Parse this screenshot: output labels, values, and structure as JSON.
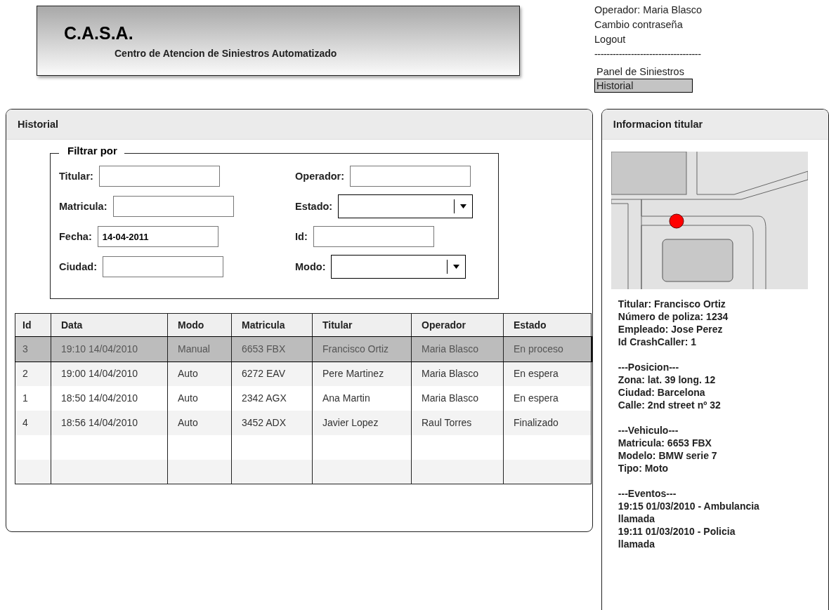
{
  "header": {
    "logo": "C.A.S.A.",
    "subtitle": "Centro de Atencion  de Siniestros Automatizado"
  },
  "user_menu": {
    "operator": "Operador: Maria Blasco",
    "change_password": "Cambio contraseña",
    "logout": "Logout",
    "separator": "-----------------------------------",
    "items": [
      {
        "label": "Panel de Siniestros",
        "selected": false
      },
      {
        "label": "Historial",
        "selected": true
      }
    ]
  },
  "history_panel": {
    "title": "Historial",
    "filter": {
      "legend": "Filtrar por",
      "fields": [
        {
          "label": "Titular:",
          "kind": "text"
        },
        {
          "label": "Operador:",
          "kind": "text"
        },
        {
          "label": "Matricula:",
          "kind": "text"
        },
        {
          "label": "Estado:",
          "kind": "select"
        },
        {
          "label": "Fecha:",
          "kind": "text",
          "value": "14-04-2011"
        },
        {
          "label": "Id:",
          "kind": "text"
        },
        {
          "label": "Ciudad:",
          "kind": "text"
        },
        {
          "label": "Modo:",
          "kind": "select"
        }
      ]
    },
    "table": {
      "columns": [
        "Id",
        "Data",
        "Modo",
        "Matricula",
        "Titular",
        "Operador",
        "Estado"
      ],
      "rows": [
        {
          "cells": [
            "3",
            "19:10 14/04/2010",
            "Manual",
            "6653 FBX",
            "Francisco Ortiz",
            "Maria Blasco",
            "En proceso"
          ],
          "selected": true
        },
        {
          "cells": [
            "2",
            "19:00 14/04/2010",
            "Auto",
            "6272 EAV",
            "Pere Martinez",
            "Maria Blasco",
            "En espera"
          ],
          "selected": false
        },
        {
          "cells": [
            "1",
            "18:50 14/04/2010",
            "Auto",
            "2342 AGX",
            "Ana Martin",
            "Maria Blasco",
            "En espera"
          ],
          "selected": false
        },
        {
          "cells": [
            "4",
            "18:56 14/04/2010",
            "Auto",
            "3452 ADX",
            "Javier Lopez",
            "Raul Torres",
            "Finalizado"
          ],
          "selected": false
        }
      ]
    }
  },
  "info_panel": {
    "title": "Informacion titular",
    "sections": [
      {
        "lines": [
          "Titular: Francisco Ortiz",
          "Número de poliza: 1234",
          "Empleado: Jose Perez",
          "Id CrashCaller: 1"
        ]
      },
      {
        "lines": [
          "---Posicion---",
          "Zona: lat. 39 long. 12",
          "Ciudad: Barcelona",
          "Calle: 2nd street nº 32"
        ]
      },
      {
        "lines": [
          "---Vehiculo---",
          "Matricula: 6653 FBX",
          "Modelo: BMW serie 7",
          "Tipo: Moto"
        ]
      },
      {
        "lines": [
          "---Eventos---",
          "19:15 01/03/2010 - Ambulancia llamada",
          "19:11 01/03/2010 - Policia llamada"
        ]
      }
    ]
  }
}
